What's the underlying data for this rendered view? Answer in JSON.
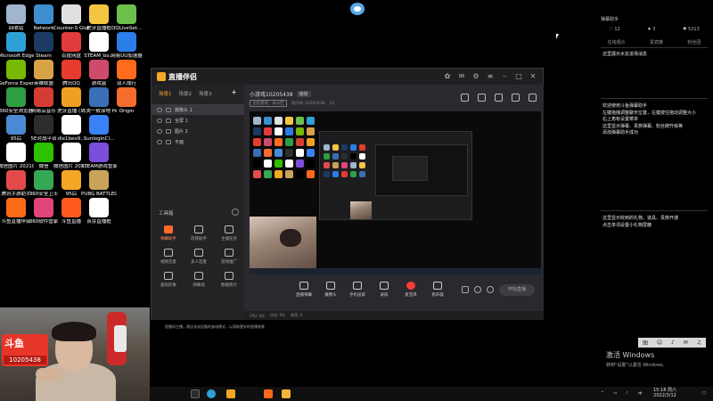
{
  "desktop_icons": [
    {
      "label": "回收站",
      "color": "#9fb6cc"
    },
    {
      "label": "Network",
      "color": "#3e8ed0"
    },
    {
      "label": "Counter-S Global Off...",
      "color": "#e0e0e0"
    },
    {
      "label": "虎牙直播框",
      "color": "#f5c542"
    },
    {
      "label": "QQLiveSet...",
      "color": "#6cbf4a"
    },
    {
      "label": "Microsoft Edge",
      "color": "#2ea0d8"
    },
    {
      "label": "Steam",
      "color": "#1b3b63"
    },
    {
      "label": "百度网盘",
      "color": "#e23b3b"
    },
    {
      "label": "STEAM_bo...",
      "color": "#ffffff"
    },
    {
      "label": "网易UU加速器",
      "color": "#2b7de9"
    },
    {
      "label": "GeForce Experience",
      "color": "#76b900"
    },
    {
      "label": "英雄联盟",
      "color": "#d8a347"
    },
    {
      "label": "腾讯QQ",
      "color": "#e63b2e"
    },
    {
      "label": "游戏盒",
      "color": "#d04a6e"
    },
    {
      "label": "双人成行",
      "color": "#ff6b1a"
    },
    {
      "label": "360安全浏览器",
      "color": "#2f9e44"
    },
    {
      "label": "网易云音乐",
      "color": "#d43c33"
    },
    {
      "label": "虎牙直播 (1)",
      "color": "#f0a020"
    },
    {
      "label": "人类一败涂地 Human Fa...",
      "color": "#3a6fb5"
    },
    {
      "label": "Origin",
      "color": "#f56c2d"
    },
    {
      "label": "95后",
      "color": "#4a8ad4"
    },
    {
      "label": "5E对战平台",
      "color": "#2d2d2d"
    },
    {
      "label": "dle1beo9...",
      "color": "#ffffff"
    },
    {
      "label": "SunloginCl...",
      "color": "#3b82f6"
    },
    {
      "label": "",
      "color": "#000000"
    },
    {
      "label": "微信图片 2021082...",
      "color": "#ffffff"
    },
    {
      "label": "微信",
      "color": "#2dc100"
    },
    {
      "label": "微信图片 2021081...",
      "color": "#ffffff"
    },
    {
      "label": "STEAM游戏管家",
      "color": "#7c4ddb"
    },
    {
      "label": "",
      "color": "#000000"
    },
    {
      "label": "腾讯手游助手",
      "color": "#e34b4b"
    },
    {
      "label": "360安全卫士",
      "color": "#34a853"
    },
    {
      "label": "95后",
      "color": "#f5a623"
    },
    {
      "label": "PUBG BATTLEGR...",
      "color": "#c9a35a"
    },
    {
      "label": "",
      "color": "#000000"
    },
    {
      "label": "斗鱼直播伴侣",
      "color": "#ff6a1a"
    },
    {
      "label": "360软件管家",
      "color": "#e0447a"
    },
    {
      "label": "斗鱼直播",
      "color": "#ff5b1f"
    },
    {
      "label": "哀芽直播框",
      "color": "#ffffff"
    }
  ],
  "app": {
    "title": "直播伴侣",
    "scene_tabs": [
      "场景1",
      "场景2",
      "场景3"
    ],
    "sources": [
      "摄像头 1",
      "全屏 1",
      "图片 2",
      "平面"
    ],
    "tools_label": "工具箱",
    "tools": [
      {
        "label": "弹幕助手",
        "hot": true
      },
      {
        "label": "房管助手",
        "hot": false
      },
      {
        "label": "主播任务",
        "hot": false
      },
      {
        "label": "视频连麦",
        "hot": false
      },
      {
        "label": "多人连麦",
        "hot": false
      },
      {
        "label": "游戏推广",
        "hot": false
      },
      {
        "label": "虚拟形象",
        "hot": false
      },
      {
        "label": "弹幕墙",
        "hot": false
      },
      {
        "label": "数据统计",
        "hot": false
      }
    ],
    "room_title": "小游戏10205438",
    "edit_label": "编辑",
    "room_tag": "主机游戏 · 未分区",
    "room_id": "房间号 10205438",
    "room_views": "12",
    "controls": [
      {
        "label": "直播弹幕",
        "red": false
      },
      {
        "label": "摄像头",
        "red": false
      },
      {
        "label": "手机投屏",
        "red": false
      },
      {
        "label": "录屏",
        "red": false
      },
      {
        "label": "麦克风",
        "red": true
      },
      {
        "label": "扬声器",
        "red": false
      }
    ],
    "live_button": "开始直播",
    "status": [
      "CPU: 0%",
      "内存: 0%",
      "帧率: 0"
    ]
  },
  "notice": "直播间主播，建议关闭设备的省电模式，以获取更好的直播效果",
  "chat": {
    "header": "弹幕助手",
    "stats": [
      "♡ 12",
      "♦ 3",
      "♥ 5213"
    ],
    "tabs": [
      "在线观众",
      "贵宾席",
      "粉丝团"
    ],
    "messages": [
      "这里展示水友进场消息",
      "欢迎使用斗鱼弹幕助手\n左键拖拽调整聊天位置，左键按住拖动调整大小\n右上角有设置菜单\n这里显示弹幕、贵族弹幕、粉丝牌升级等\n添加弹幕助手成功",
      "这里显示收到的礼物、道具、贵族开通\n点击单词设置小礼物屏蔽"
    ]
  },
  "emoji_bar": [
    "图",
    "☺",
    "♪",
    "✉",
    "♫"
  ],
  "windows_activation": {
    "line1": "激活 Windows",
    "line2": "转到\"设置\"以激活 Windows。"
  },
  "stream_overlay": {
    "brand_top": "斗鱼",
    "room_no": "10205438"
  },
  "taskbar": {
    "time": "15:18 周六",
    "date": "2022/3/12"
  }
}
